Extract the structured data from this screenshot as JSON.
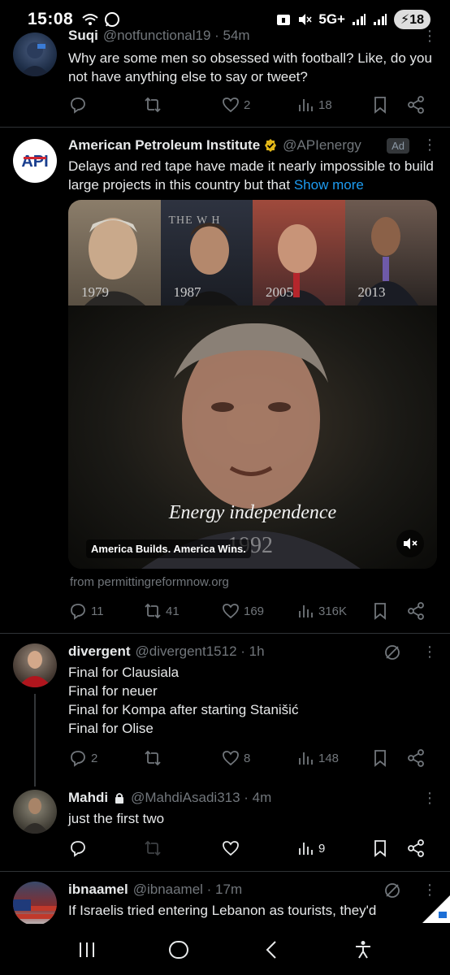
{
  "status_bar": {
    "time": "15:08",
    "network": "5G+",
    "battery": "18"
  },
  "tweets": [
    {
      "name": "Suqi",
      "handle": "@notfunctional19 · 54m",
      "text": "Why are some men so obsessed with football? Like, do you not have anything else to say or tweet?",
      "replies": "",
      "retweets": "",
      "likes": "2",
      "views": "18"
    },
    {
      "name": "American Petroleum Institute",
      "handle": "@APIenergy",
      "ad_label": "Ad",
      "text": "Delays and red tape have made it nearly impossible to build large projects in this country but that",
      "show_more": "Show more",
      "media": {
        "years": [
          "1979",
          "1987",
          "2005",
          "2013"
        ],
        "thumb_caption": "THE W   H",
        "overlay_text": "Energy independence",
        "big_year": "1992",
        "caption": "America Builds. America Wins."
      },
      "from": "from permittingreformnow.org",
      "replies": "11",
      "retweets": "41",
      "likes": "169",
      "views": "316K"
    },
    {
      "name": "divergent",
      "handle": "@divergent1512 · 1h",
      "lines": [
        "Final for Clausiala",
        "Final for neuer",
        "Final for Kompa after starting Stanišić",
        "Final for Olise"
      ],
      "replies": "2",
      "retweets": "",
      "likes": "8",
      "views": "148"
    },
    {
      "name": "Mahdi",
      "handle": "@MahdiAsadi313 · 4m",
      "text": "just the first two",
      "replies": "",
      "retweets": "",
      "likes": "",
      "views": "9"
    },
    {
      "name": "ibnaamel",
      "handle": "@ibnaamel · 17m",
      "text": "If Israelis tried entering Lebanon as tourists, they'd"
    }
  ],
  "colors": {
    "background": "#000000",
    "text": "#e7e9ea",
    "muted": "#71767b",
    "link": "#1d9bf0",
    "verified_gold": "#e2b719"
  }
}
